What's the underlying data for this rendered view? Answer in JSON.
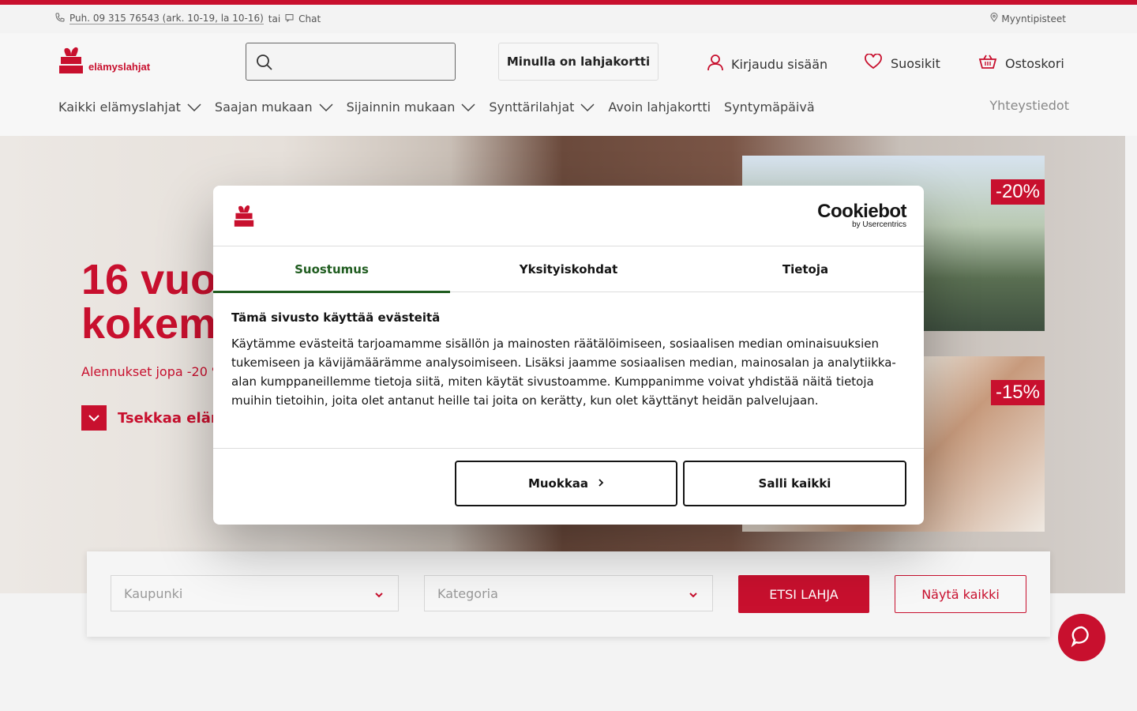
{
  "utility": {
    "phone": "Puh. 09 315 76543 (ark. 10-19, la 10-16)",
    "or": "tai",
    "chat": "Chat",
    "stores": "Myyntipisteet"
  },
  "header": {
    "logo_text": "elämyslahjat",
    "search_placeholder": "",
    "giftcard_button": "Minulla on lahjakortti",
    "login": "Kirjaudu sisään",
    "favorites": "Suosikit",
    "cart": "Ostoskori"
  },
  "nav": {
    "items": [
      {
        "label": "Kaikki elämyslahjat",
        "has_dropdown": true
      },
      {
        "label": "Saajan mukaan",
        "has_dropdown": true
      },
      {
        "label": "Sijainnin mukaan",
        "has_dropdown": true
      },
      {
        "label": "Synttärilahjat",
        "has_dropdown": true
      },
      {
        "label": "Avoin lahjakortti",
        "has_dropdown": false
      },
      {
        "label": "Syntymäpäivä",
        "has_dropdown": false
      }
    ],
    "contact": "Yhteystiedot"
  },
  "hero": {
    "title_line1": "16 vuo",
    "title_line2": "kokem",
    "subtitle": "Alennukset jopa -20 %",
    "cta": "Tsekkaa eläm",
    "promos": [
      {
        "badge": "-20%"
      },
      {
        "badge": "-15%"
      }
    ]
  },
  "finder": {
    "city_placeholder": "Kaupunki",
    "category_placeholder": "Kategoria",
    "search_button": "ETSI LAHJA",
    "show_all_button": "Näytä kaikki"
  },
  "cookie_modal": {
    "brand_main": "Cookiebot",
    "brand_sub": "by Usercentrics",
    "tabs": [
      "Suostumus",
      "Yksityiskohdat",
      "Tietoja"
    ],
    "active_tab": "Suostumus",
    "heading": "Tämä sivusto käyttää evästeitä",
    "body": "Käytämme evästeitä tarjoamamme sisällön ja mainosten räätälöimiseen, sosiaalisen median ominaisuuksien tukemiseen ja kävijämäärämme analysoimiseen. Lisäksi jaamme sosiaalisen median, mainosalan ja analytiikka-alan kumppaneillemme tietoja siitä, miten käytät sivustoamme. Kumppanimme voivat yhdistää näitä tietoja muihin tietoihin, joita olet antanut heille tai joita on kerätty, kun olet käyttänyt heidän palvelujaan.",
    "customize_button": "Muokkaa",
    "allow_all_button": "Salli kaikki"
  },
  "colors": {
    "brand_red": "#c8102e",
    "tab_active_green": "#1f5c1f"
  }
}
